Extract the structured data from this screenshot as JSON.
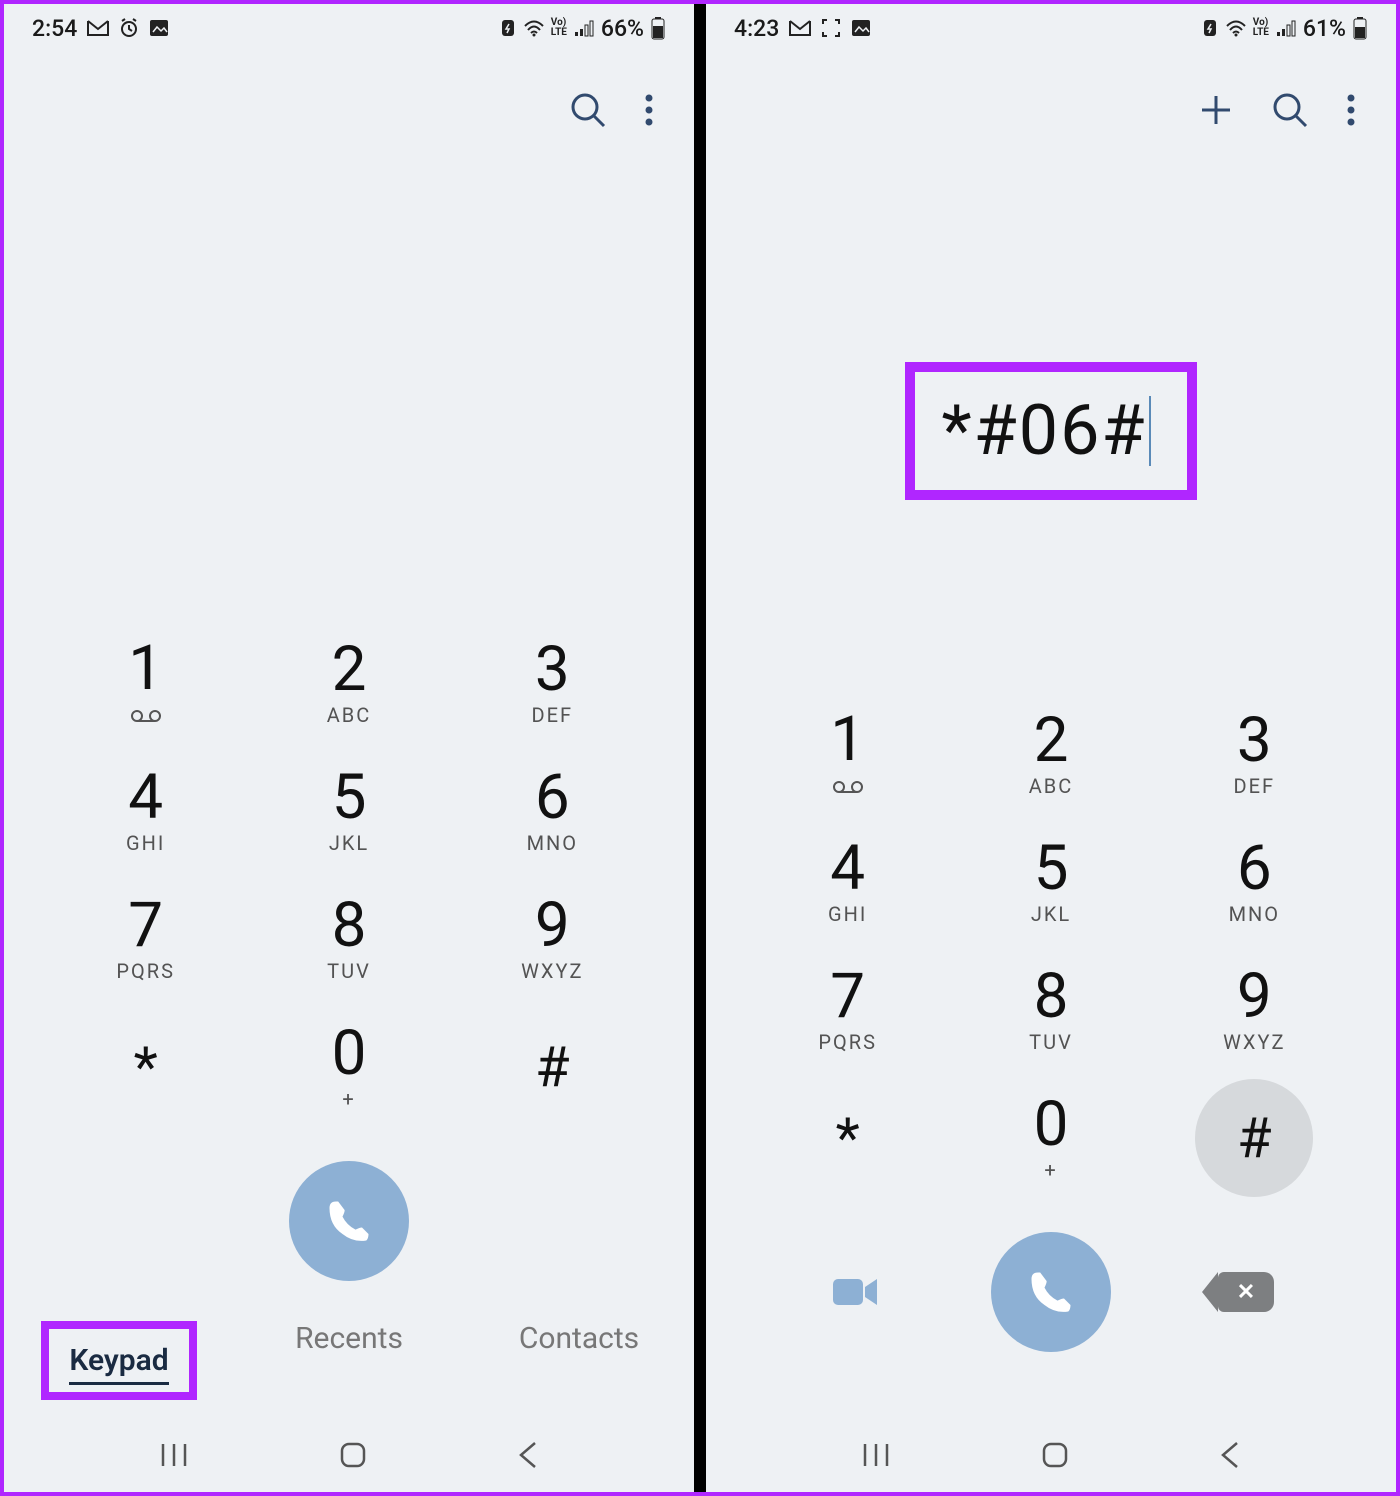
{
  "left": {
    "status": {
      "time": "2:54",
      "battery": "66%"
    },
    "dialed": "",
    "keys": [
      {
        "d": "1",
        "s": "voicemail"
      },
      {
        "d": "2",
        "s": "ABC"
      },
      {
        "d": "3",
        "s": "DEF"
      },
      {
        "d": "4",
        "s": "GHI"
      },
      {
        "d": "5",
        "s": "JKL"
      },
      {
        "d": "6",
        "s": "MNO"
      },
      {
        "d": "7",
        "s": "PQRS"
      },
      {
        "d": "8",
        "s": "TUV"
      },
      {
        "d": "9",
        "s": "WXYZ"
      },
      {
        "d": "*",
        "s": ""
      },
      {
        "d": "0",
        "s": "+"
      },
      {
        "d": "#",
        "s": ""
      }
    ],
    "tabs": {
      "keypad": "Keypad",
      "recents": "Recents",
      "contacts": "Contacts"
    }
  },
  "right": {
    "status": {
      "time": "4:23",
      "battery": "61%"
    },
    "dialed": "*#06#",
    "keys": [
      {
        "d": "1",
        "s": "voicemail"
      },
      {
        "d": "2",
        "s": "ABC"
      },
      {
        "d": "3",
        "s": "DEF"
      },
      {
        "d": "4",
        "s": "GHI"
      },
      {
        "d": "5",
        "s": "JKL"
      },
      {
        "d": "6",
        "s": "MNO"
      },
      {
        "d": "7",
        "s": "PQRS"
      },
      {
        "d": "8",
        "s": "TUV"
      },
      {
        "d": "9",
        "s": "WXYZ"
      },
      {
        "d": "*",
        "s": ""
      },
      {
        "d": "0",
        "s": "+"
      },
      {
        "d": "#",
        "s": ""
      }
    ]
  },
  "highlights": {
    "left_tab_keypad": true,
    "right_dialed": true
  },
  "colors": {
    "accent": "#b026ff",
    "call_button": "#8db0d4",
    "toolbar_icon": "#314a6e"
  }
}
